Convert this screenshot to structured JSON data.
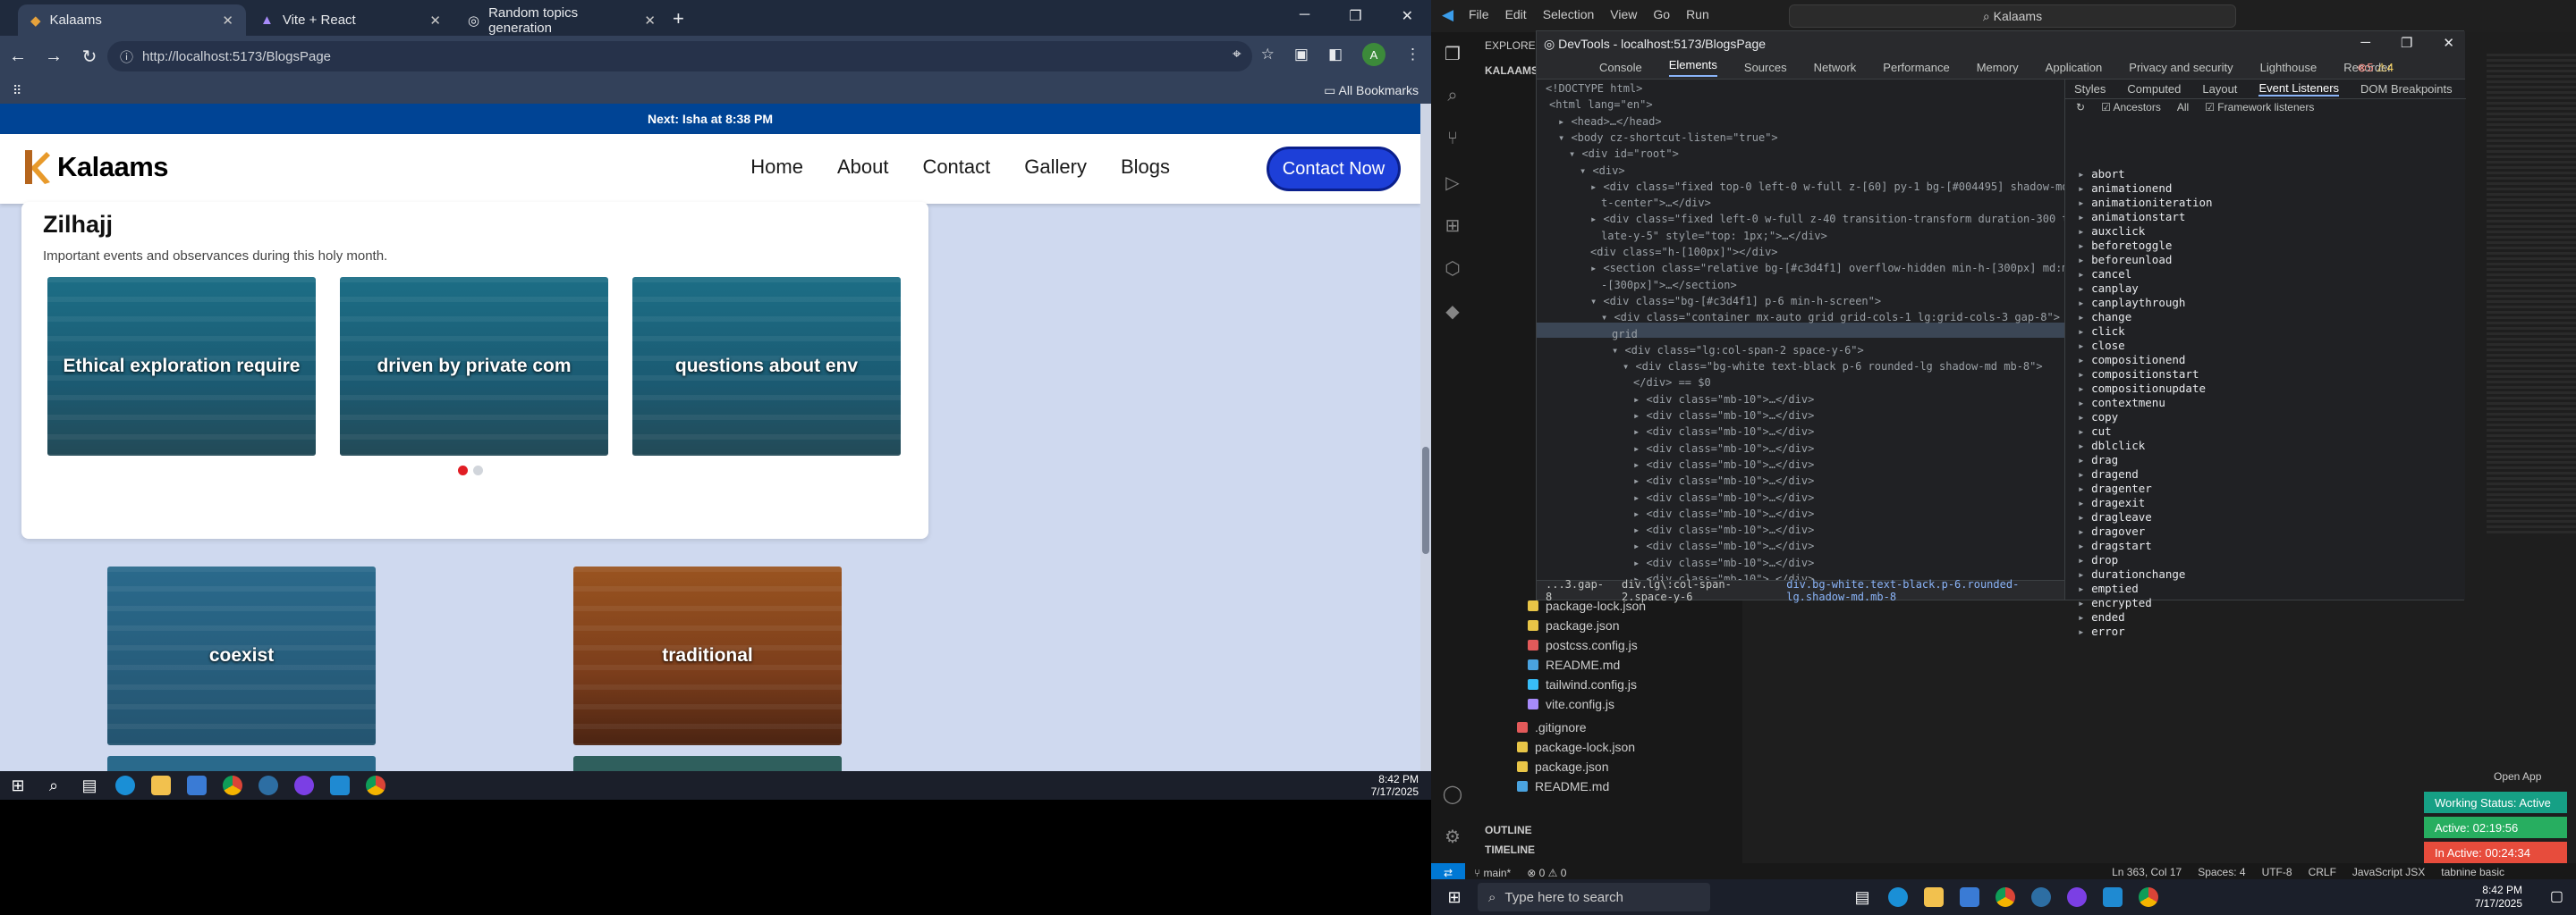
{
  "browser": {
    "tabs": [
      {
        "label": "Kalaams"
      },
      {
        "label": "Vite + React"
      },
      {
        "label": "Random topics generation"
      }
    ],
    "url": "http://localhost:5173/BlogsPage",
    "bookmarks_label": "All Bookmarks"
  },
  "site": {
    "announcement": "Next: Isha at 8:38 PM",
    "logo_text": "Kalaams",
    "menu": [
      "Home",
      "About",
      "Contact",
      "Gallery",
      "Blogs"
    ],
    "cta": "Contact Now",
    "section_title": "Zilhajj",
    "section_sub": "Important events and observances during this holy month.",
    "slides": [
      "Ethical exploration require",
      "driven by private com",
      "questions about env"
    ],
    "tiles": [
      "coexist",
      "traditional"
    ]
  },
  "taskbar1": {
    "time": "8:42 PM",
    "date": "7/17/2025"
  },
  "vscode": {
    "menu": [
      "File",
      "Edit",
      "Selection",
      "View",
      "Go",
      "Run"
    ],
    "search": "Kalaams",
    "explorer_title": "EXPLORER",
    "project": "KALAAMS",
    "files": [
      "package-lock.json",
      "package.json",
      "postcss.config.js",
      "README.md",
      "tailwind.config.js",
      "vite.config.js",
      ".gitignore",
      "package-lock.json",
      "package.json",
      "README.md"
    ],
    "outline": "OUTLINE",
    "timeline": "TIMELINE",
    "open_app": "Open App",
    "status": {
      "branch": "main*",
      "errors": "0",
      "warnings": "0",
      "position": "Ln 363, Col 17",
      "spaces": "Spaces: 4",
      "encoding": "UTF-8",
      "eol": "CRLF",
      "language": "JavaScript JSX",
      "tabnine": "tabnine basic"
    },
    "badges": {
      "working": "Working Status: Active",
      "active": "Active: 02:19:56",
      "inactive": "In Active: 00:24:34"
    }
  },
  "devtools": {
    "title": "DevTools - localhost:5173/BlogsPage",
    "tabs": [
      "Console",
      "Elements",
      "Sources",
      "Network",
      "Performance",
      "Memory",
      "Application",
      "Privacy and security",
      "Lighthouse",
      "Recorder"
    ],
    "errors": "5",
    "warnings": "4",
    "side_tabs": [
      "Styles",
      "Computed",
      "Layout",
      "Event Listeners",
      "DOM Breakpoints"
    ],
    "ancestors": "Ancestors",
    "all": "All",
    "framework": "Framework listeners",
    "crumbs": [
      "...3.gap-8",
      "div.lg\\:col-span-2.space-y-6",
      "div.bg-white.text-black.p-6.rounded-lg.shadow-md.mb-8"
    ],
    "events": [
      "abort",
      "animationend",
      "animationiteration",
      "animationstart",
      "auxclick",
      "beforetoggle",
      "beforeunload",
      "cancel",
      "canplay",
      "canplaythrough",
      "change",
      "click",
      "close",
      "compositionend",
      "compositionstart",
      "compositionupdate",
      "contextmenu",
      "copy",
      "cut",
      "dblclick",
      "drag",
      "dragend",
      "dragenter",
      "dragexit",
      "dragleave",
      "dragover",
      "dragstart",
      "drop",
      "durationchange",
      "emptied",
      "encrypted",
      "ended",
      "error"
    ]
  },
  "taskbar2": {
    "search": "Type here to search",
    "time": "8:42 PM",
    "date": "7/17/2025"
  }
}
